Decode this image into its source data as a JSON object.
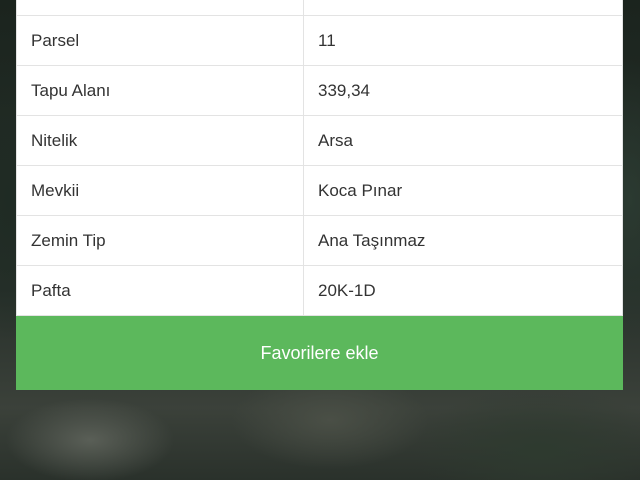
{
  "parcel_info": {
    "rows": [
      {
        "label": "",
        "value": ""
      },
      {
        "label": "Parsel",
        "value": "11"
      },
      {
        "label": "Tapu Alanı",
        "value": "339,34"
      },
      {
        "label": "Nitelik",
        "value": "Arsa"
      },
      {
        "label": "Mevkii",
        "value": "Koca Pınar"
      },
      {
        "label": "Zemin Tip",
        "value": "Ana Taşınmaz"
      },
      {
        "label": "Pafta",
        "value": "20K-1D"
      }
    ]
  },
  "actions": {
    "favorite_label": "Favorilere ekle"
  },
  "colors": {
    "button_green": "#5cb85c",
    "table_border": "#e3e3e3",
    "text": "#333333"
  }
}
